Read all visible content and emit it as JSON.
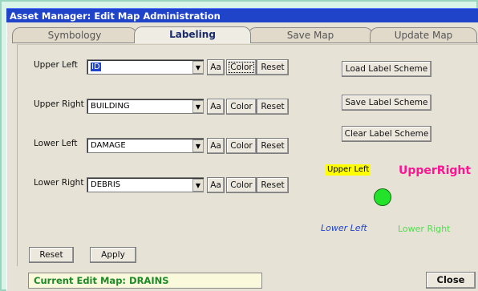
{
  "window": {
    "title": "Asset Manager: Edit Map Administration"
  },
  "tabs": [
    {
      "label": "Symbology"
    },
    {
      "label": "Labeling"
    },
    {
      "label": "Save Map"
    },
    {
      "label": "Update Map"
    }
  ],
  "rows": [
    {
      "label": "Upper Left",
      "value": "ID"
    },
    {
      "label": "Upper Right",
      "value": "BUILDING"
    },
    {
      "label": "Lower Left",
      "value": "DAMAGE"
    },
    {
      "label": "Lower Right",
      "value": "DEBRIS"
    }
  ],
  "row_buttons": {
    "font": "Aa",
    "color": "Color",
    "reset": "Reset"
  },
  "scheme_buttons": {
    "load": "Load Label Scheme",
    "save": "Save Label Scheme",
    "clear": "Clear Label Scheme"
  },
  "preview": {
    "upper_left": "Upper Left",
    "upper_right": "UpperRight",
    "lower_left": "Lower Left",
    "lower_right": "Lower Right",
    "colors": {
      "upper_left_bg": "#ffff00",
      "upper_right": "#ff1493",
      "lower_left": "#1f44c9",
      "lower_right": "#4ce04c",
      "point": "#22e22a"
    }
  },
  "footer": {
    "reset": "Reset",
    "apply": "Apply",
    "status": "Current Edit Map: DRAINS",
    "close": "Close"
  }
}
